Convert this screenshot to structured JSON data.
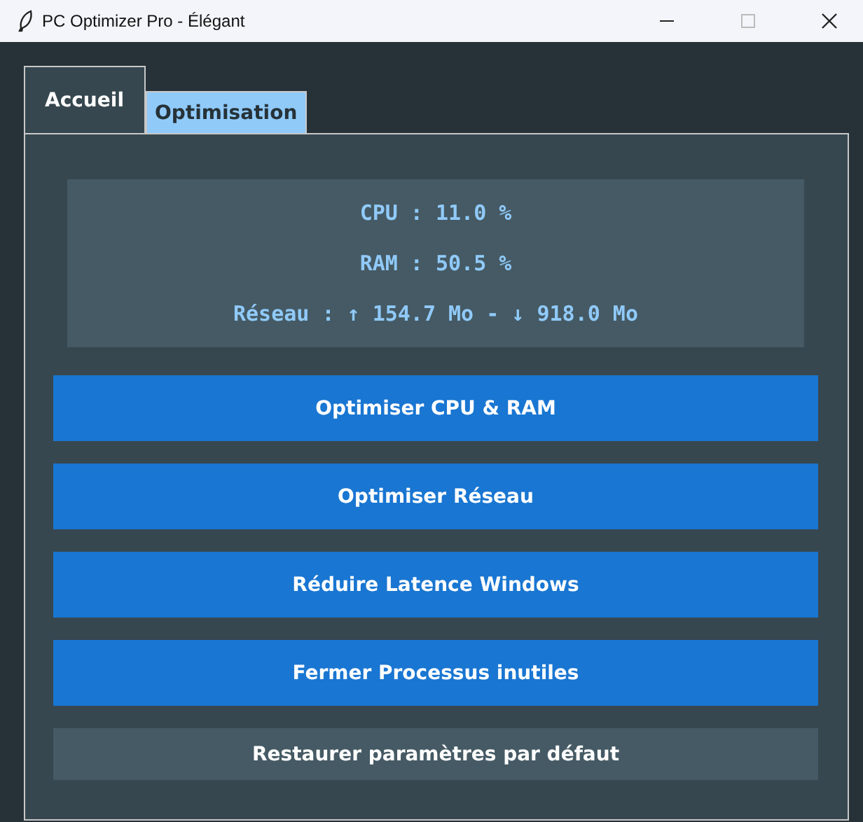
{
  "window": {
    "title": "PC Optimizer Pro - Élégant"
  },
  "tabs": [
    {
      "label": "Accueil",
      "selected": true
    },
    {
      "label": "Optimisation",
      "selected": false
    }
  ],
  "stats": [
    "CPU : 11.0 %",
    "RAM : 50.5 %",
    "Réseau : ↑ 154.7 Mo - ↓ 918.0 Mo"
  ],
  "buttons": [
    {
      "label": "Optimiser CPU & RAM",
      "kind": "primary"
    },
    {
      "label": "Optimiser Réseau",
      "kind": "primary"
    },
    {
      "label": "Réduire Latence Windows",
      "kind": "primary"
    },
    {
      "label": "Fermer Processus inutiles",
      "kind": "primary"
    },
    {
      "label": "Restaurer paramètres par défaut",
      "kind": "secondary"
    }
  ]
}
